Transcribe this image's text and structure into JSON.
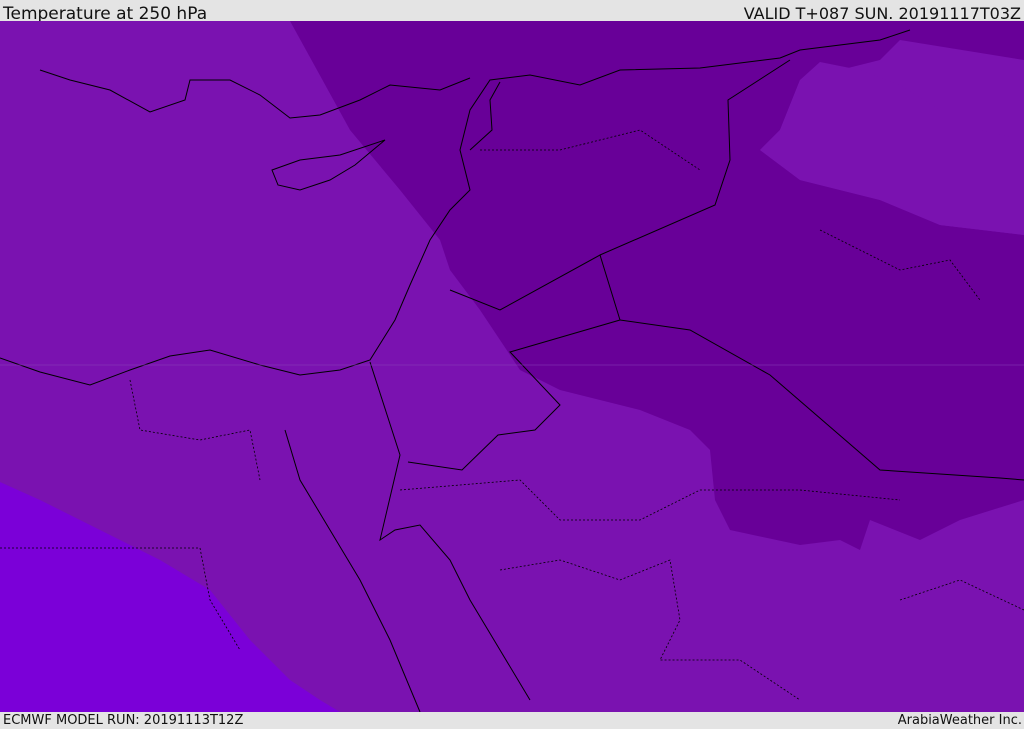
{
  "header": {
    "title": "Temperature at 250 hPa",
    "valid": "VALID T+087 SUN. 20191117T03Z"
  },
  "footer": {
    "model_run": "ECMWF MODEL RUN: 20191113T12Z",
    "credit": "ArabiaWeather Inc."
  },
  "colors": {
    "base": "#7a12b0",
    "cold": "#680098",
    "warm": "#7b00d8",
    "border": "#000000"
  }
}
